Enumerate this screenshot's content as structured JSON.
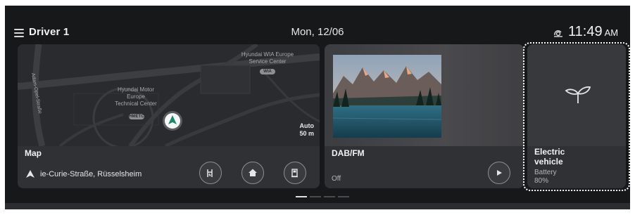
{
  "header": {
    "driver_label": "Driver 1",
    "date": "Mon, 12/06",
    "time": "11:49",
    "ampm": "AM"
  },
  "map_card": {
    "title": "Map",
    "street": "ie-Curie-Straße, Rüsselsheim",
    "labels": {
      "service_center_line1": "Hyundai WIA Europe",
      "service_center_line2": "Service Center",
      "tech_center_line1": "Hyundai Motor",
      "tech_center_line2": "Europe",
      "tech_center_line3": "Technical Center",
      "road_name": "Adam-Opel-Straße",
      "scale_mode": "Auto",
      "scale_distance": "50 m"
    },
    "buttons": [
      "charging-station",
      "home",
      "fuel"
    ]
  },
  "radio_card": {
    "title": "DAB/FM",
    "status": "Off"
  },
  "ev_card": {
    "title_line1": "Electric",
    "title_line2": "vehicle",
    "subtitle": "Battery",
    "battery": "80%"
  },
  "pager": {
    "pages": 4,
    "active": 1
  },
  "colors": {
    "background": "#17181a",
    "card": "#2e2f33",
    "highlight_border": "#ffffff",
    "active_indicator": "#e0e0e0"
  }
}
